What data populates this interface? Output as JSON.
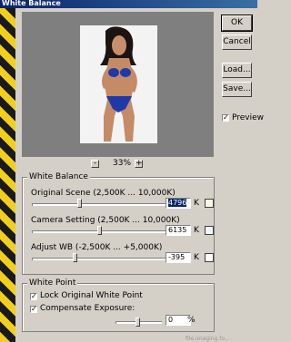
{
  "window": {
    "title": "White Balance"
  },
  "buttons": {
    "ok": "OK",
    "cancel": "Cancel",
    "load": "Load...",
    "save": "Save..."
  },
  "preview": {
    "label": "Preview",
    "checked": true
  },
  "zoom": {
    "minus": "-",
    "value": "33%",
    "plus": "+"
  },
  "white_balance": {
    "title": "White Balance",
    "original_scene": {
      "label": "Original Scene (2,500K ... 10,000K)",
      "value": "4796",
      "unit": "K",
      "swatch": "#f7f7e4"
    },
    "camera_setting": {
      "label": "Camera Setting (2,500K ... 10,000K)",
      "value": "6135",
      "unit": "K",
      "swatch": "#eef7f8"
    },
    "adjust_wb": {
      "label": "Adjust WB (-2,500K ... +5,000K)",
      "value": "-395",
      "unit": "K",
      "swatch": "#ffffff"
    }
  },
  "white_point": {
    "title": "White Point",
    "lock_label": "Lock Original White Point",
    "lock_checked": true,
    "compensate_label": "Compensate Exposure:",
    "compensate_checked": true,
    "exposure_value": "0",
    "exposure_unit": "%"
  },
  "watermark": "file.imaging.fo..."
}
